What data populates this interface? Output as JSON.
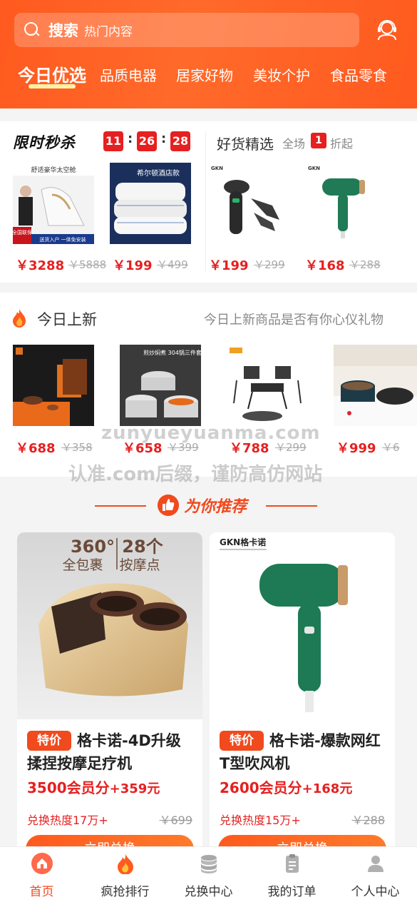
{
  "header": {
    "search_title": "搜索",
    "search_placeholder": "热门内容",
    "tabs": [
      {
        "label": "今日优选",
        "active": true
      },
      {
        "label": "品质电器"
      },
      {
        "label": "居家好物"
      },
      {
        "label": "美妆个护"
      },
      {
        "label": "食品零食"
      }
    ],
    "accent": "#ff5a1f"
  },
  "flash_sale": {
    "title": "限时秒杀",
    "timer": [
      "11",
      "26",
      "28"
    ],
    "goods_title": "好货精选",
    "goods_sub": "全场",
    "goods_badge": "1",
    "goods_sub2": "折起",
    "items": [
      {
        "price": "￥3288",
        "old": "￥5888",
        "img_text": "舒适豪华太空舱",
        "img_tag": "全国联保",
        "img_caption": "送货入户 一体免安装"
      },
      {
        "price": "￥199",
        "old": "￥499",
        "img_text": "希尔顿酒店款"
      },
      {
        "price": "￥199",
        "old": "￥299",
        "img_text": "GKN"
      },
      {
        "price": "￥168",
        "old": "￥288",
        "img_text": "GKN"
      }
    ]
  },
  "new_today": {
    "title": "今日上新",
    "subtitle": "今日上新商品是否有你心仪礼物",
    "items": [
      {
        "price": "￥688",
        "old": "￥358"
      },
      {
        "price": "￥658",
        "old": "￥399",
        "img_text": "煎炒焖煮 304锅三件套"
      },
      {
        "price": "￥788",
        "old": "￥299"
      },
      {
        "price": "￥999",
        "old": "￥6"
      }
    ]
  },
  "watermark": {
    "line1": "zunyueyuanma.com",
    "line2": "认准.com后缀，谨防高仿网站"
  },
  "recommend": {
    "title": "为你推荐",
    "cards": [
      {
        "tag": "特价",
        "name": "格卡诺-4D升级揉捏按摩足疗机",
        "points": "3500会员分",
        "cash": "+359元",
        "heat": "兑换热度17万+",
        "old": "￥699",
        "button": "立即兑换",
        "img_line1": "360°",
        "img_line2": "全包裹",
        "img_line3": "28个",
        "img_line4": "按摩点"
      },
      {
        "tag": "特价",
        "name": "格卡诺-爆款网红T型吹风机",
        "points": "2600会员分",
        "cash": "+168元",
        "heat": "兑换热度15万+",
        "old": "￥288",
        "button": "立即兑换",
        "img_brand": "GKN格卡诺"
      }
    ]
  },
  "nav": [
    {
      "label": "首页",
      "icon": "home-icon",
      "active": true
    },
    {
      "label": "疯抢排行",
      "icon": "fire-icon"
    },
    {
      "label": "兑换中心",
      "icon": "coins-icon"
    },
    {
      "label": "我的订单",
      "icon": "order-icon"
    },
    {
      "label": "个人中心",
      "icon": "user-icon"
    }
  ]
}
